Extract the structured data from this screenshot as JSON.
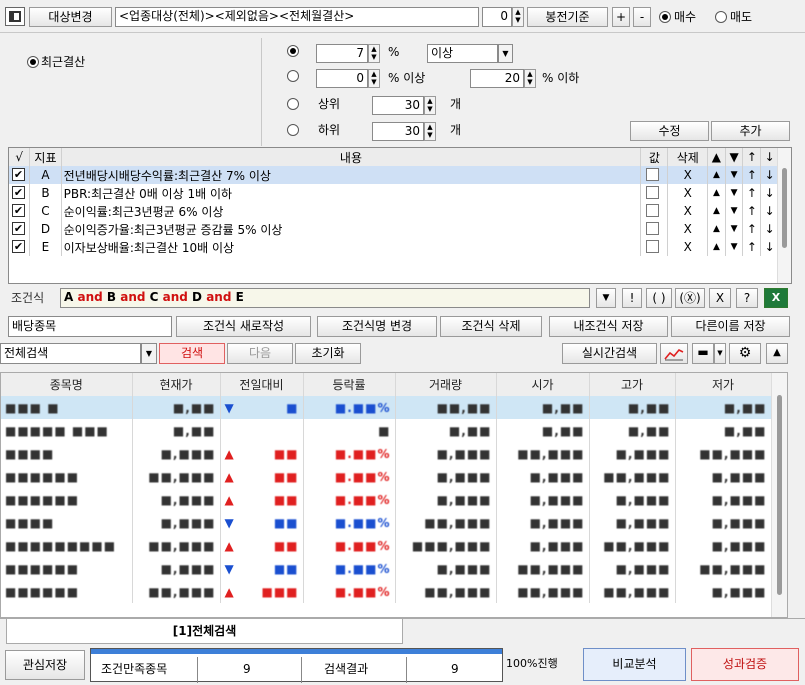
{
  "toolbar": {
    "menu_icon": "panel-icon",
    "target_change_label": "대상변경",
    "filter_text": "<업종대상(전체)><제외없음><전체월결산>",
    "count_value": "0",
    "bongjeon_label": "봉전기준",
    "plus_label": "+",
    "minus_label": "-",
    "buy_label": "매수",
    "sell_label": "매도"
  },
  "condition_panel": {
    "recent_settlement_label": "최근결산",
    "value1": "7",
    "pct1": "%",
    "compare_value": "이상",
    "value2_from": "0",
    "pct_from_label": "% 이상",
    "value2_to": "20",
    "pct_to_label": "% 이하",
    "top_label": "상위",
    "top_value": "30",
    "top_unit": "개",
    "bottom_label": "하위",
    "bottom_value": "30",
    "bottom_unit": "개",
    "edit_label": "수정",
    "add_label": "추가"
  },
  "conditions_table": {
    "headers": [
      "√",
      "지표",
      "내용",
      "값",
      "삭제",
      "▲",
      "▼",
      "↑",
      "↓"
    ],
    "rows": [
      {
        "id": "A",
        "content": "전년배당시배당수익률:최근결산 7% 이상",
        "delete": "X"
      },
      {
        "id": "B",
        "content": "PBR:최근결산 0배 이상 1배 이하",
        "delete": "X"
      },
      {
        "id": "C",
        "content": "순이익률:최근3년평균 6% 이상",
        "delete": "X"
      },
      {
        "id": "D",
        "content": "순이익증가율:최근3년평균 증감률 5% 이상",
        "delete": "X"
      },
      {
        "id": "E",
        "content": "이자보상배율:최근결산 10배 이상",
        "delete": "X"
      }
    ]
  },
  "formula": {
    "label": "조건식",
    "expression": "A and B and C and D and E",
    "btn_not": "!",
    "btn_paren": "( )",
    "btn_x_circle": "(Ⓧ)",
    "btn_x": "X",
    "btn_help": "?"
  },
  "actions": {
    "name_value": "배당종목",
    "new_label": "조건식 새로작성",
    "rename_label": "조건식명 변경",
    "delete_label": "조건식 삭제",
    "save_label": "내조건식 저장",
    "save_as_label": "다른이름 저장"
  },
  "search_bar": {
    "scope_value": "전체검색",
    "search_label": "검색",
    "next_label": "다음",
    "reset_label": "초기화",
    "realtime_label": "실시간검색"
  },
  "results": {
    "headers": [
      "종목명",
      "현재가",
      "전일대비",
      "등락률",
      "거래량",
      "시가",
      "고가",
      "저가"
    ],
    "rows": [
      {
        "name": "■■■ ■",
        "price": "■,■■",
        "dir": "down",
        "change": "■",
        "rate": "■.■■%",
        "volume": "■■,■■",
        "open": "■,■■",
        "high": "■,■■",
        "low": "■,■■"
      },
      {
        "name": "■■■■■ ■■■",
        "price": "■,■■",
        "dir": "none",
        "change": "",
        "rate": "■",
        "volume": "■,■■",
        "open": "■,■■",
        "high": "■,■■",
        "low": "■,■■"
      },
      {
        "name": "■■■■",
        "price": "■,■■■",
        "dir": "up",
        "change": "■■",
        "rate": "■.■■%",
        "volume": "■,■■■",
        "open": "■■,■■■",
        "high": "■,■■■",
        "low": "■■,■■■"
      },
      {
        "name": "■■■■■■",
        "price": "■■,■■■",
        "dir": "up",
        "change": "■■",
        "rate": "■.■■%",
        "volume": "■,■■■",
        "open": "■,■■■",
        "high": "■■,■■■",
        "low": "■,■■■"
      },
      {
        "name": "■■■■■■",
        "price": "■,■■■",
        "dir": "up",
        "change": "■■",
        "rate": "■.■■%",
        "volume": "■,■■■",
        "open": "■,■■■",
        "high": "■,■■■",
        "low": "■,■■■"
      },
      {
        "name": "■■■■",
        "price": "■,■■■",
        "dir": "down",
        "change": "■■",
        "rate": "■.■■%",
        "volume": "■■,■■■",
        "open": "■,■■■",
        "high": "■,■■■",
        "low": "■,■■■"
      },
      {
        "name": "■■■■■■■■■",
        "price": "■■,■■■",
        "dir": "up",
        "change": "■■",
        "rate": "■.■■%",
        "volume": "■■■,■■■",
        "open": "■,■■■",
        "high": "■■,■■■",
        "low": "■,■■■"
      },
      {
        "name": "■■■■■■",
        "price": "■,■■■",
        "dir": "down",
        "change": "■■",
        "rate": "■.■■%",
        "volume": "■,■■■",
        "open": "■■,■■■",
        "high": "■,■■■",
        "low": "■■,■■■"
      },
      {
        "name": "■■■■■■",
        "price": "■■,■■■",
        "dir": "up",
        "change": "■■■",
        "rate": "■.■■%",
        "volume": "■■,■■■",
        "open": "■■,■■■",
        "high": "■■,■■■",
        "low": "■,■■■"
      }
    ]
  },
  "tab": {
    "label": "[1]전체검색"
  },
  "footer": {
    "watch_save_label": "관심저장",
    "match_label": "조건만족종목",
    "match_count": "9",
    "result_label": "검색결과",
    "result_count": "9",
    "progress_label": "100%진행",
    "progress": 1.0,
    "compare_label": "비교분석",
    "perf_label": "성과검증"
  },
  "colors": {
    "up": "#e02020",
    "down": "#1a4fd0",
    "accent": "#3d7fd8"
  }
}
